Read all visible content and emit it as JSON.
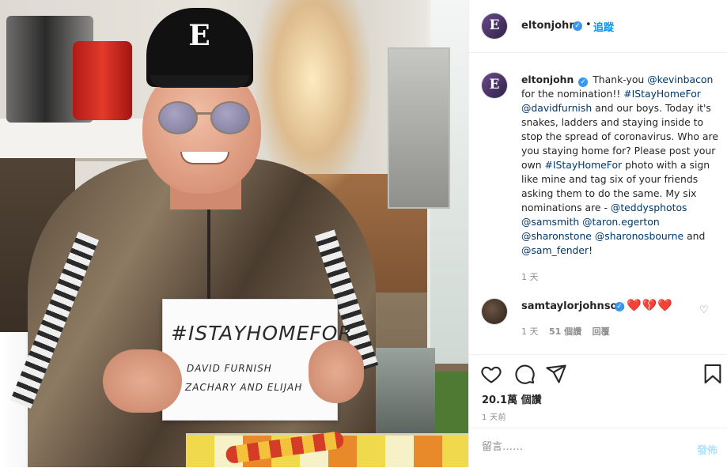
{
  "post": {
    "author": "eltonjohn",
    "avatar_letter": "E",
    "follow_label": "追蹤",
    "dot": "•",
    "photo_alt": "Elton John holding a sign reading #IStayHomeFor",
    "photo_sign": {
      "line1": "#ISTAYHOMEFOR",
      "line2": "DAVID FURNISH",
      "line3": "ZACHARY AND ELIJAH"
    },
    "cap_logo": "E",
    "caption": {
      "author": "eltonjohn",
      "segments": [
        {
          "text": "Thank-you "
        },
        {
          "text": "@kevinbacon",
          "link": true
        },
        {
          "text": " for the nomination!! "
        },
        {
          "text": "#IStayHomeFor",
          "link": true
        },
        {
          "text": " "
        },
        {
          "text": "@davidfurnish",
          "link": true
        },
        {
          "text": " and our boys. Today it's snakes, ladders and staying inside to stop the spread of coronavirus. Who are you staying home for? Please post your own "
        },
        {
          "text": "#IStayHomeFor",
          "link": true
        },
        {
          "text": " photo with a sign like mine and tag six of your friends asking them to do the same. My six nominations are - "
        },
        {
          "text": "@teddysphotos",
          "link": true
        },
        {
          "text": " "
        },
        {
          "text": "@samsmith",
          "link": true
        },
        {
          "text": " "
        },
        {
          "text": "@taron.egerton",
          "link": true
        },
        {
          "text": " "
        },
        {
          "text": "@sharonstone",
          "link": true
        },
        {
          "text": " "
        },
        {
          "text": "@sharonosbourne",
          "link": true
        },
        {
          "text": " and "
        },
        {
          "text": "@sam_fender",
          "link": true
        },
        {
          "text": "!"
        }
      ],
      "time": "1 天"
    },
    "comment": {
      "user": "samtaylorjohnson",
      "text": "❤️💔❤️",
      "time": "1 天",
      "likes": "51 個讚",
      "reply": "回覆"
    },
    "stats": {
      "views": "20.1萬 個讚",
      "posted": "1 天前"
    },
    "comment_box": {
      "placeholder": "留言……",
      "post_label": "發佈"
    },
    "colors": {
      "link": "#00376b",
      "follow": "#0095f6",
      "verified": "#3897f0",
      "heart": "#e0112a"
    }
  }
}
